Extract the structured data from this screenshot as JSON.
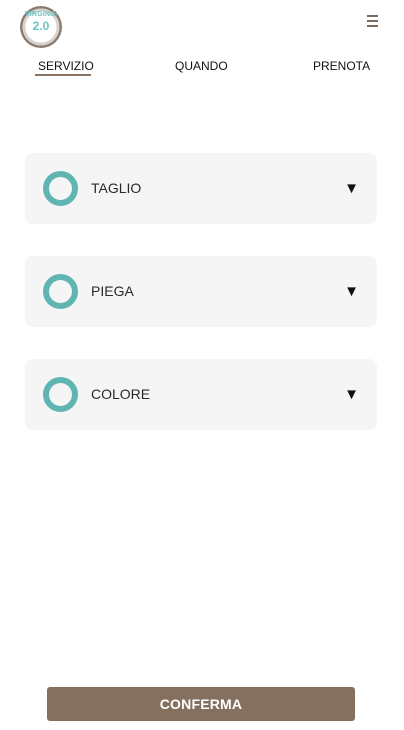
{
  "header": {
    "logo_text": "VIRGINIE",
    "logo_number": "2.0",
    "menu_icon": "hamburger-menu-icon"
  },
  "tabs": [
    {
      "label": "SERVIZIO",
      "active": true
    },
    {
      "label": "QUANDO",
      "active": false
    },
    {
      "label": "PRENOTA",
      "active": false
    }
  ],
  "services": [
    {
      "label": "TAGLIO",
      "expand_icon": "▼"
    },
    {
      "label": "PIEGA",
      "expand_icon": "▼"
    },
    {
      "label": "COLORE",
      "expand_icon": "▼"
    }
  ],
  "footer": {
    "confirm_label": "CONFERMA"
  },
  "colors": {
    "accent_teal": "#5fb5b1",
    "brand_brown": "#85705f",
    "card_bg": "#f5f5f5"
  }
}
